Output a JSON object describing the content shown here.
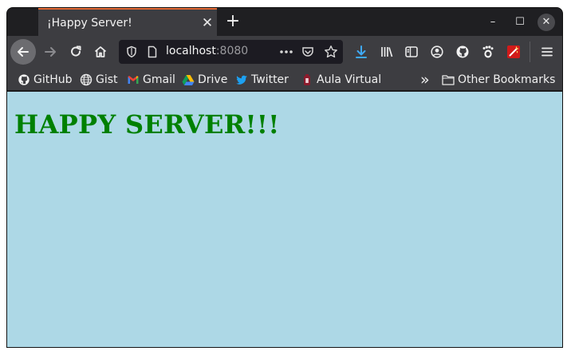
{
  "tab": {
    "title": "¡Happy Server!",
    "close_glyph": "✕"
  },
  "new_tab_glyph": "+",
  "window_controls": {
    "minimize": "–",
    "maximize": "☐",
    "close": "✕"
  },
  "url": {
    "host": "localhost",
    "port": ":8080"
  },
  "bookmarks": [
    {
      "label": "GitHub",
      "icon": "github-icon"
    },
    {
      "label": "Gist",
      "icon": "globe-icon"
    },
    {
      "label": "Gmail",
      "icon": "gmail-icon"
    },
    {
      "label": "Drive",
      "icon": "drive-icon"
    },
    {
      "label": "Twitter",
      "icon": "twitter-icon"
    },
    {
      "label": "Aula Virtual",
      "icon": "aula-icon"
    }
  ],
  "bookmarks_overflow_glyph": "»",
  "other_bookmarks": "Other Bookmarks",
  "page": {
    "heading": "HAPPY SERVER!!!"
  },
  "colors": {
    "page_bg": "#add8e6",
    "heading": "#008000",
    "tab_accent": "#e36a36"
  }
}
